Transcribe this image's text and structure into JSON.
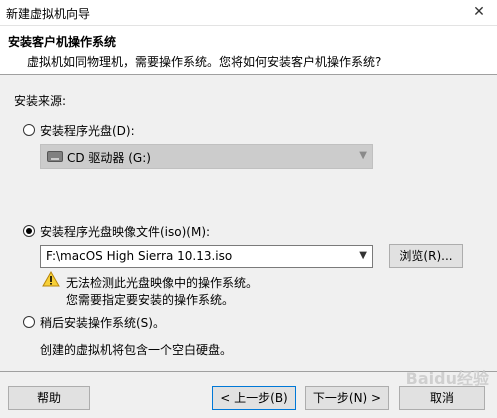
{
  "window": {
    "title": "新建虚拟机向导",
    "close_glyph": "✕"
  },
  "header": {
    "title": "安装客户机操作系统",
    "subtitle": "虚拟机如同物理机，需要操作系统。您将如何安装客户机操作系统?"
  },
  "install_source": {
    "label": "安装来源:",
    "options": [
      {
        "label": "安装程序光盘(D):",
        "checked": false
      },
      {
        "label": "安装程序光盘映像文件(iso)(M):",
        "checked": true
      },
      {
        "label": "稍后安装操作系统(S)。",
        "checked": false
      }
    ],
    "cd_combo": {
      "value": "CD 驱动器 (G:)",
      "icon": "cd-drive-icon",
      "disabled": true
    },
    "iso_combo": {
      "value": "F:\\macOS High Sierra 10.13.iso"
    },
    "browse_label": "浏览(R)...",
    "warning": {
      "icon": "warning-icon",
      "line1": "无法检测此光盘映像中的操作系统。",
      "line2": "您需要指定要安装的操作系统。"
    },
    "later_note": "创建的虚拟机将包含一个空白硬盘。"
  },
  "footer": {
    "help": "帮助",
    "back": "< 上一步(B)",
    "next": "下一步(N) >",
    "cancel": "取消"
  },
  "watermark": "Baidu经验"
}
